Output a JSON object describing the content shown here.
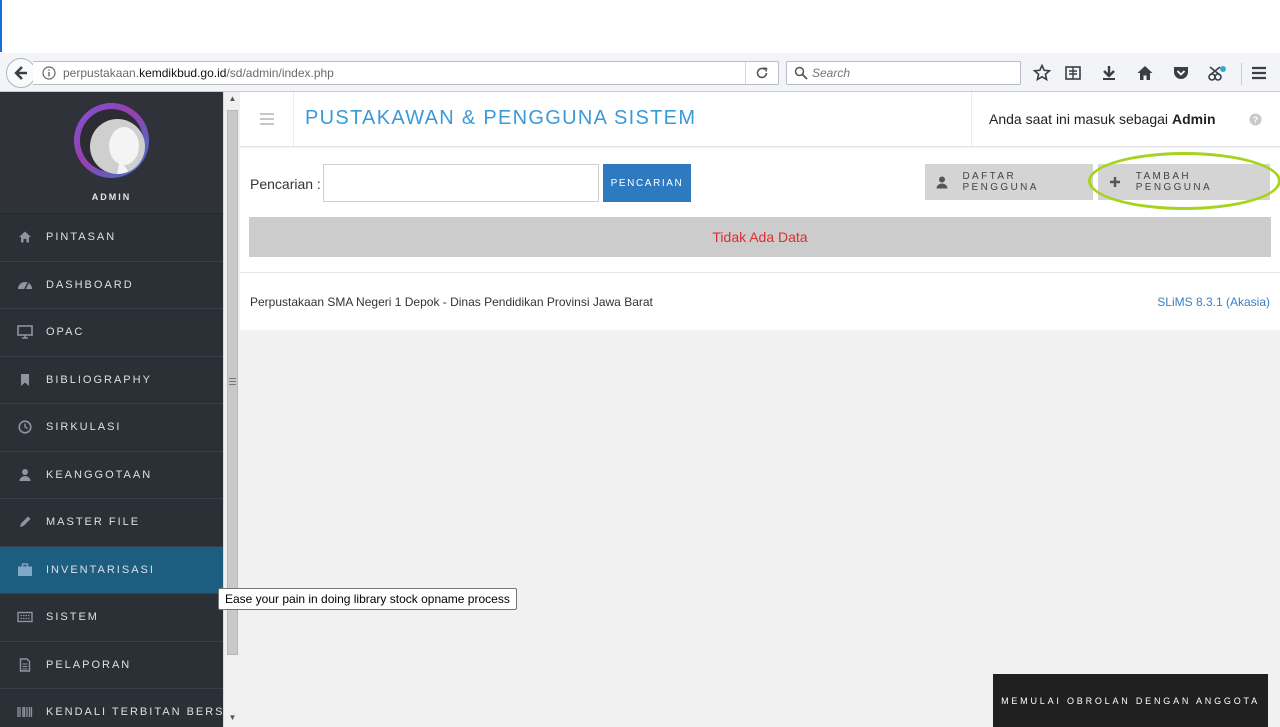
{
  "browser": {
    "url_prefix": "perpustakaan.",
    "url_domain": "kemdikbud.go.id",
    "url_path": "/sd/admin/index.php",
    "search_placeholder": "Search"
  },
  "sidebar": {
    "profile_name": "ADMIN",
    "items": [
      {
        "label": "PINTASAN",
        "icon": "home-icon"
      },
      {
        "label": "DASHBOARD",
        "icon": "dashboard-icon"
      },
      {
        "label": "OPAC",
        "icon": "monitor-icon"
      },
      {
        "label": "BIBLIOGRAPHY",
        "icon": "bookmark-icon"
      },
      {
        "label": "SIRKULASI",
        "icon": "clock-icon"
      },
      {
        "label": "KEANGGOTAAN",
        "icon": "user-icon"
      },
      {
        "label": "MASTER FILE",
        "icon": "pencil-icon"
      },
      {
        "label": "INVENTARISASI",
        "icon": "briefcase-icon"
      },
      {
        "label": "SISTEM",
        "icon": "keyboard-icon"
      },
      {
        "label": "PELAPORAN",
        "icon": "document-icon"
      },
      {
        "label": "KENDALI TERBITAN BERSERI",
        "icon": "barcode-icon"
      }
    ],
    "active_index": 7
  },
  "header": {
    "title": "PUSTAKAWAN & PENGGUNA SISTEM",
    "login_prefix": "Anda saat ini masuk sebagai",
    "login_user": "Admin"
  },
  "search": {
    "label": "Pencarian :",
    "button": "PENCARIAN",
    "value": ""
  },
  "actions": {
    "daftar": "DAFTAR PENGGUNA",
    "tambah": "TAMBAH PENGGUNA"
  },
  "results": {
    "empty_message": "Tidak Ada Data"
  },
  "footer": {
    "left": "Perpustakaan SMA Negeri 1 Depok - Dinas Pendidikan Provinsi Jawa Barat",
    "right": "SLiMS 8.3.1 (Akasia)"
  },
  "tooltip": "Ease your pain in doing library stock opname process",
  "chat_button": "MEMULAI OBROLAN DENGAN ANGGOTA",
  "colors": {
    "sidebar_bg": "#2b2f36",
    "active_item": "#1c5d80",
    "title_blue": "#3a9ad9",
    "primary_button": "#2e7ac0",
    "empty_text": "#e32c2c",
    "highlight": "#a7d31f"
  }
}
